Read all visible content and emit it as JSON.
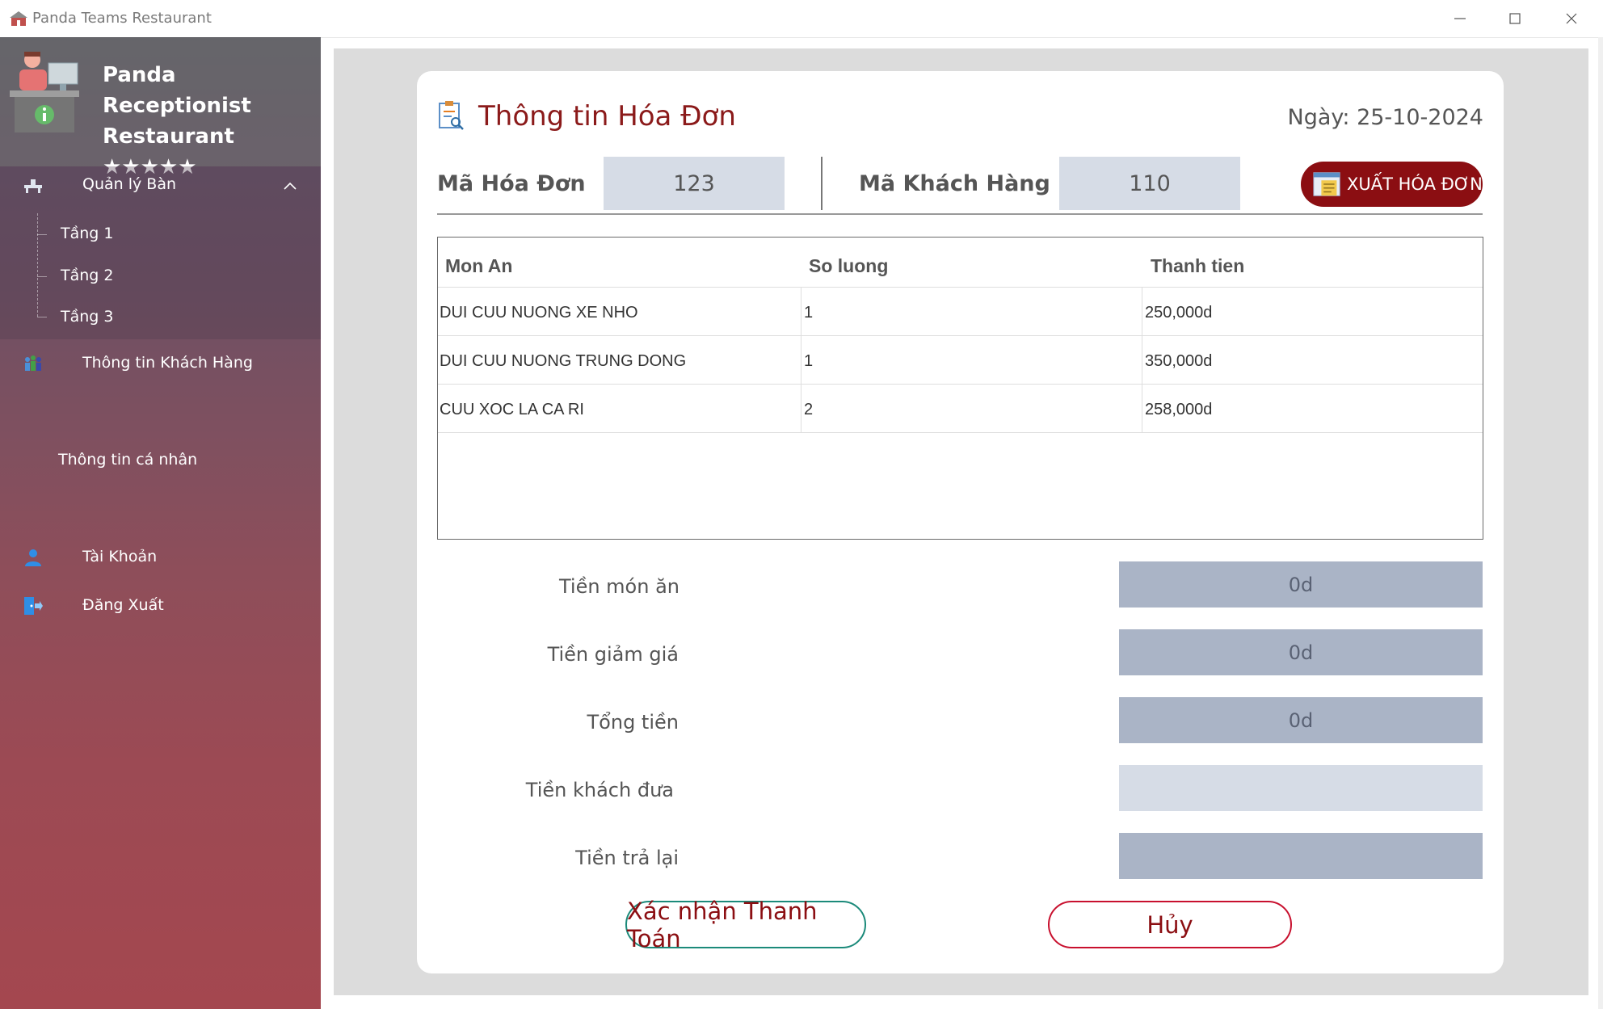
{
  "window": {
    "title": "Panda Teams Restaurant"
  },
  "sidebar": {
    "brand_line1": "Panda Receptionist",
    "brand_line2": "Restaurant ★★★★★",
    "tables_menu": {
      "label": "Quản lý Bàn",
      "floors": [
        "Tầng 1",
        "Tầng 2",
        "Tầng 3"
      ]
    },
    "customers_label": "Thông tin Khách Hàng",
    "profile_label": "Thông tin cá nhân",
    "account_label": "Tài Khoản",
    "logout_label": "Đăng Xuất"
  },
  "invoice": {
    "heading": "Thông tin Hóa Đơn",
    "date": "Ngày: 25-10-2024",
    "invoice_id_label": "Mã Hóa Đơn",
    "invoice_id": "123",
    "customer_id_label": "Mã Khách Hàng",
    "customer_id": "110",
    "export_label": "XUẤT HÓA ĐƠN"
  },
  "table": {
    "headers": [
      "Mon An",
      "So luong",
      "Thanh tien"
    ],
    "rows": [
      [
        "DUI CUU NUONG XE NHO",
        "1",
        "250,000d"
      ],
      [
        "DUI CUU NUONG TRUNG DONG",
        "1",
        "350,000d"
      ],
      [
        "CUU XOC LA CA RI",
        "2",
        "258,000d"
      ]
    ]
  },
  "summary": {
    "food_label": "Tiền món ăn",
    "food_value": "0d",
    "discount_label": "Tiền giảm giá",
    "discount_value": "0d",
    "total_label": "Tổng tiền",
    "total_value": "0d",
    "paid_label": "Tiền khách đưa",
    "paid_value": "",
    "change_label": "Tiền trả lại",
    "change_value": ""
  },
  "actions": {
    "confirm_label": "Xác nhận Thanh Toán",
    "cancel_label": "Hủy"
  },
  "colors": {
    "accent": "#8b0e12",
    "heading": "#8b1a1a",
    "input_bg": "#d6dce6",
    "readonly_bg": "#aab4c6"
  }
}
